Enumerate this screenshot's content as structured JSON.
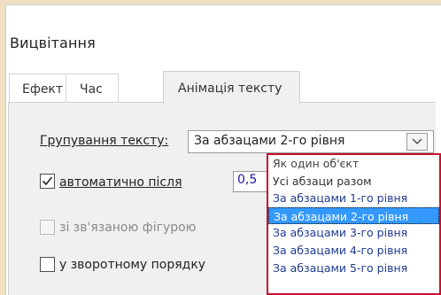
{
  "dialog": {
    "title": "Вицвітання",
    "tabs": [
      {
        "label": "Ефект"
      },
      {
        "label": "Час"
      },
      {
        "label": "Анімація тексту"
      }
    ],
    "grouping": {
      "label": "Групування тексту:",
      "value": "За абзацами 2-го рівня"
    },
    "auto_after": {
      "label": "автоматично після",
      "checked": true,
      "value": "0,5"
    },
    "attached_shape": {
      "label": "зі зв'язаною фігурою",
      "checked": false,
      "enabled": false
    },
    "reverse_order": {
      "label": "у зворотному порядку",
      "checked": false
    },
    "dropdown_options": [
      "Як один об'єкт",
      "Усі абзаци разом",
      "За абзацами 1-го рівня",
      "За абзацами 2-го рівня",
      "За абзацами 3-го рівня",
      "За абзацами 4-го рівня",
      "За абзацами 5-го рівня"
    ],
    "selected_index": 3
  },
  "colors": {
    "highlight": "#3399ff",
    "dropdown_border": "#c8102e",
    "background": "#f0dfc3"
  }
}
